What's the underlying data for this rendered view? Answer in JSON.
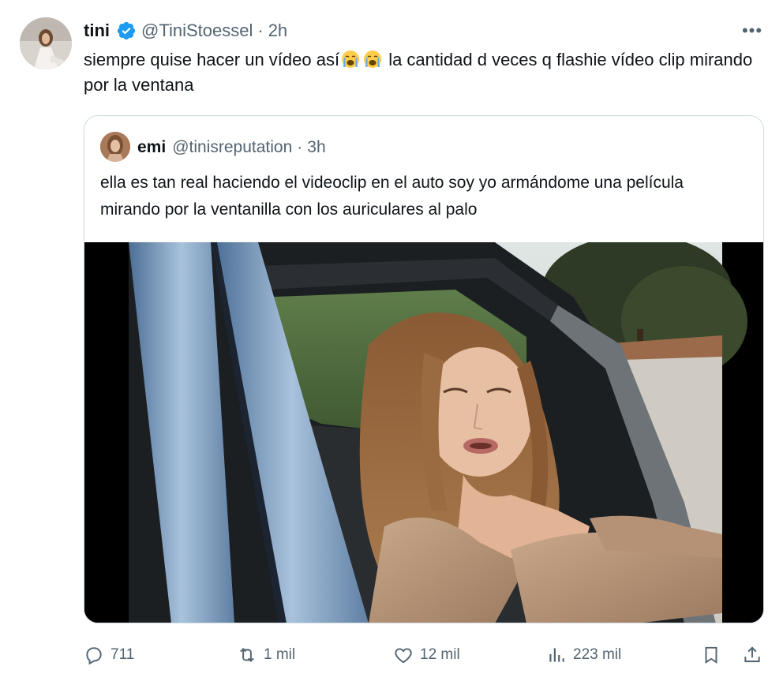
{
  "tweet": {
    "author_name": "tini",
    "handle": "@TiniStoessel",
    "separator": "·",
    "time": "2h",
    "more_label": "•••",
    "text_before_emoji": "siempre quise hacer un vídeo así",
    "text_after_emoji": " la cantidad d veces q flashie vídeo clip mirando por la ventana"
  },
  "quote": {
    "author_name": "emi",
    "handle": "@tinisreputation",
    "separator": "·",
    "time": "3h",
    "text": "ella es tan real haciendo el videoclip en el auto soy yo armándome una película mirando por la ventanilla con los auriculares al palo"
  },
  "actions": {
    "replies": "711",
    "reposts": "1 mil",
    "likes": "12 mil",
    "views": "223 mil"
  },
  "colors": {
    "verified": "#1d9bf0",
    "muted": "#536471",
    "border": "#cfd9de",
    "text": "#0f1419"
  },
  "icons": [
    "verified-badge-icon",
    "crying-face-emoji",
    "reply-icon",
    "repost-icon",
    "like-icon",
    "views-icon",
    "bookmark-icon",
    "share-icon"
  ]
}
